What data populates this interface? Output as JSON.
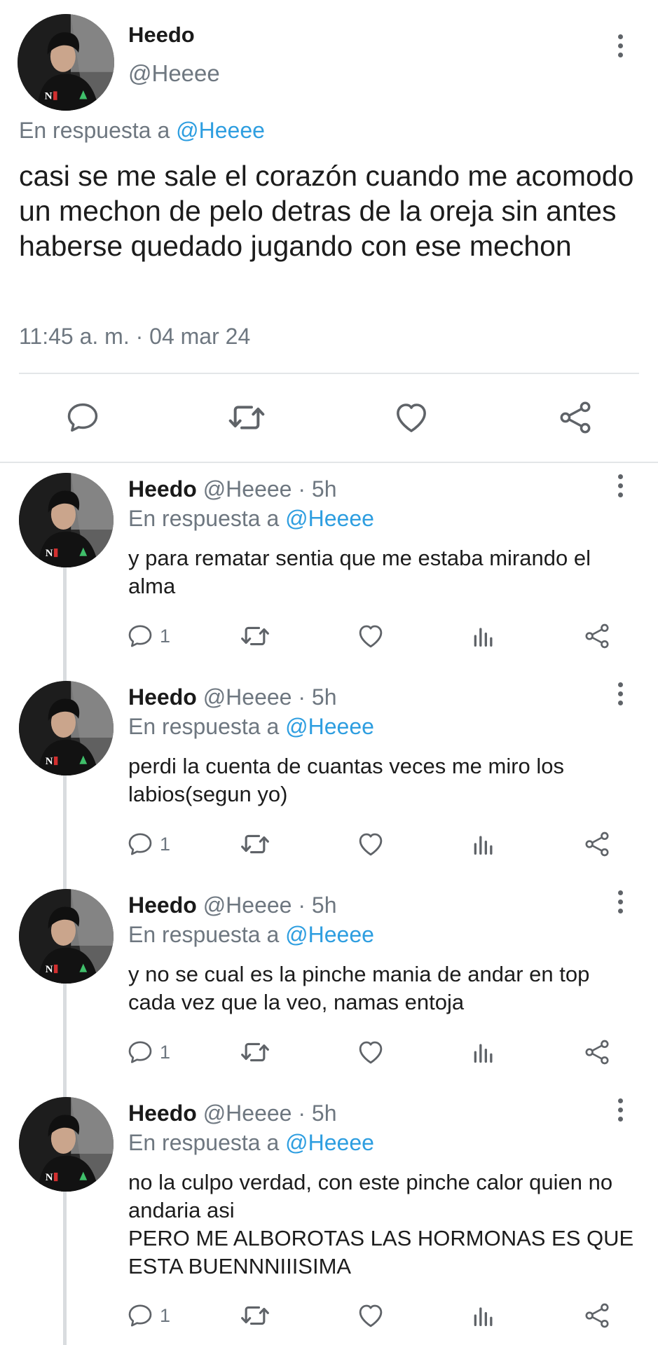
{
  "main_tweet": {
    "name": "Heedo",
    "handle": "@Heeee",
    "reply_prefix": "En respuesta a",
    "reply_to": "@Heeee",
    "text": "casi se me sale el corazón cuando me acomodo un mechon de pelo detras de la oreja sin antes haberse quedado jugando con ese mechon",
    "timestamp": "11:45 a. m. · 04 mar 24",
    "actions": [
      "comment-icon",
      "retweet-icon",
      "heart-icon",
      "share-icon"
    ]
  },
  "replies": [
    {
      "name": "Heedo",
      "handle": "@Heeee",
      "time": "· 5h",
      "reply_prefix": "En respuesta a",
      "reply_to": "@Heeee",
      "text": "y para rematar sentia que me estaba mirando el alma",
      "comment_count": "1"
    },
    {
      "name": "Heedo",
      "handle": "@Heeee",
      "time": "· 5h",
      "reply_prefix": "En respuesta a",
      "reply_to": "@Heeee",
      "text": "perdi la cuenta de cuantas veces me miro los labios(segun yo)",
      "comment_count": "1"
    },
    {
      "name": "Heedo",
      "handle": "@Heeee",
      "time": "· 5h",
      "reply_prefix": "En respuesta a",
      "reply_to": "@Heeee",
      "text": "y no se cual es la pinche mania de andar en top cada vez que la veo, namas entoja",
      "comment_count": "1"
    },
    {
      "name": "Heedo",
      "handle": "@Heeee",
      "time": "· 5h",
      "reply_prefix": "En respuesta a",
      "reply_to": "@Heeee",
      "text": "no la culpo verdad, con este pinche calor quien no andaria asi\nPERO ME ALBOROTAS LAS HORMONAS ES QUE ESTA BUENNNIIISIMA",
      "comment_count": "1"
    }
  ],
  "colors": {
    "link": "#2e9ee0",
    "secondary_text": "#6e7780",
    "icon": "#5f6368",
    "divider": "#e3e6e8"
  }
}
